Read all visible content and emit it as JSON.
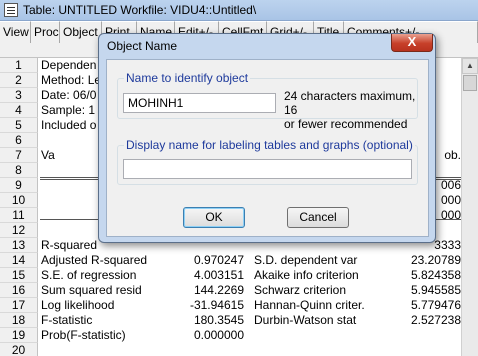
{
  "window": {
    "title": "Table: UNTITLED    Workfile: VIDU4::Untitled\\"
  },
  "toolbar": [
    "View",
    "Proc",
    "Object",
    "Print",
    "Name",
    "Edit+/-",
    "CellFmt",
    "Grid+/-",
    "Title",
    "Comments+/-"
  ],
  "sheet": {
    "rows": [
      {
        "n": "1",
        "a": "Dependen",
        "b": "",
        "c": "",
        "d": ""
      },
      {
        "n": "2",
        "a": "Method: Le",
        "b": "",
        "c": "",
        "d": ""
      },
      {
        "n": "3",
        "a": "Date: 06/0",
        "b": "",
        "c": "",
        "d": ""
      },
      {
        "n": "4",
        "a": "Sample: 1",
        "b": "",
        "c": "",
        "d": ""
      },
      {
        "n": "5",
        "a": "Included o",
        "b": "",
        "c": "",
        "d": ""
      },
      {
        "n": "6",
        "a": "",
        "b": "",
        "c": "",
        "d": ""
      },
      {
        "n": "7",
        "a": "Va",
        "b": "",
        "c": "",
        "d": "ob."
      },
      {
        "n": "8",
        "a": "",
        "b": "",
        "c": "",
        "d": ""
      },
      {
        "n": "9",
        "a": "",
        "b": "",
        "c": "",
        "d": "006"
      },
      {
        "n": "10",
        "a": "",
        "b": "",
        "c": "",
        "d": "000"
      },
      {
        "n": "11",
        "a": "",
        "b": "",
        "c": "",
        "d": "000"
      },
      {
        "n": "12",
        "a": "",
        "b": "",
        "c": "",
        "d": ""
      },
      {
        "n": "13",
        "a": "R-squared",
        "b": "",
        "c": "",
        "d": "3333"
      },
      {
        "n": "14",
        "a": "Adjusted R-squared",
        "b": "0.970247",
        "c": "S.D. dependent var",
        "d": "23.20789"
      },
      {
        "n": "15",
        "a": "S.E. of regression",
        "b": "4.003151",
        "c": "Akaike info criterion",
        "d": "5.824358"
      },
      {
        "n": "16",
        "a": "Sum squared resid",
        "b": "144.2269",
        "c": "Schwarz criterion",
        "d": "5.945585"
      },
      {
        "n": "17",
        "a": "Log likelihood",
        "b": "-31.94615",
        "c": "Hannan-Quinn criter.",
        "d": "5.779476"
      },
      {
        "n": "18",
        "a": "F-statistic",
        "b": "180.3545",
        "c": "Durbin-Watson stat",
        "d": "2.527238"
      },
      {
        "n": "19",
        "a": "Prob(F-statistic)",
        "b": "0.000000",
        "c": "",
        "d": ""
      },
      {
        "n": "20",
        "a": "",
        "b": "",
        "c": "",
        "d": ""
      }
    ]
  },
  "dialog": {
    "title": "Object Name",
    "close_label": "X",
    "name_group": {
      "legend": "Name to identify object",
      "value": "MOHINH1",
      "hint_line1": "24 characters maximum, 16",
      "hint_line2": "or fewer recommended"
    },
    "display_group": {
      "legend": "Display name for labeling tables and graphs  (optional)",
      "value": ""
    },
    "ok_label": "OK",
    "cancel_label": "Cancel"
  }
}
